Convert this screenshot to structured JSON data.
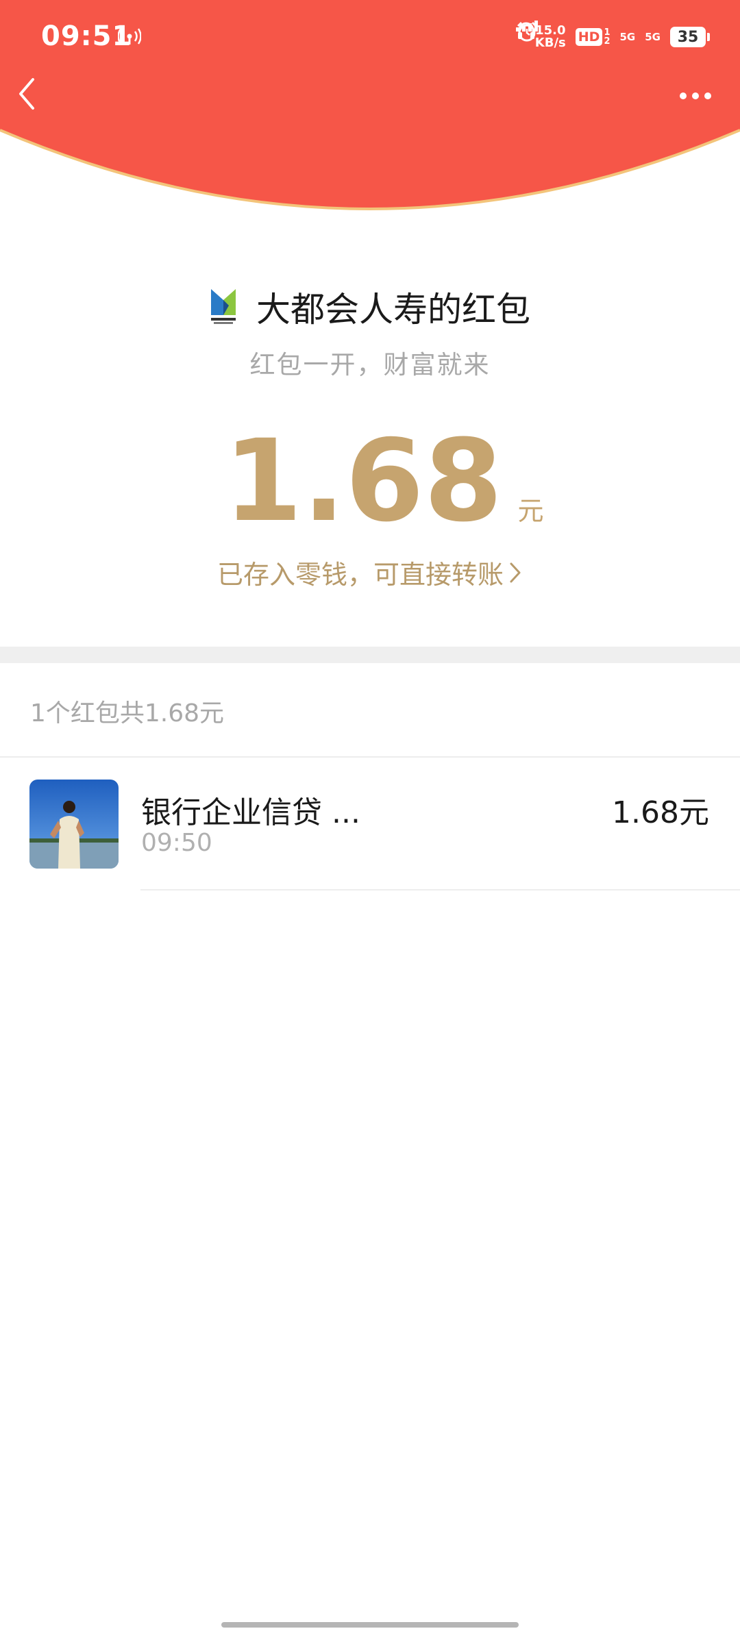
{
  "status_bar": {
    "time": "09:51",
    "network_speed_value": "15.0",
    "network_speed_unit": "KB/s",
    "hd_label": "HD",
    "sim1_label": "5G",
    "sim2_label": "5G",
    "battery": "35"
  },
  "header": {
    "back_icon": "chevron-left-icon",
    "more_icon": "more-horizontal-icon",
    "accent_color": "#f65648",
    "arc_border_color": "#f3c47a"
  },
  "packet": {
    "sender_logo": "metlife-logo",
    "sender_name": "大都会人寿的红包",
    "blessing": "红包一开，财富就来",
    "amount": "1.68",
    "unit": "元",
    "deposit_link": "已存入零钱，可直接转账",
    "gold_color": "#c6a46f"
  },
  "summary": "1个红包共1.68元",
  "receivers": [
    {
      "name": "银行企业信贷 ...",
      "time": "09:50",
      "amount": "1.68元"
    }
  ]
}
